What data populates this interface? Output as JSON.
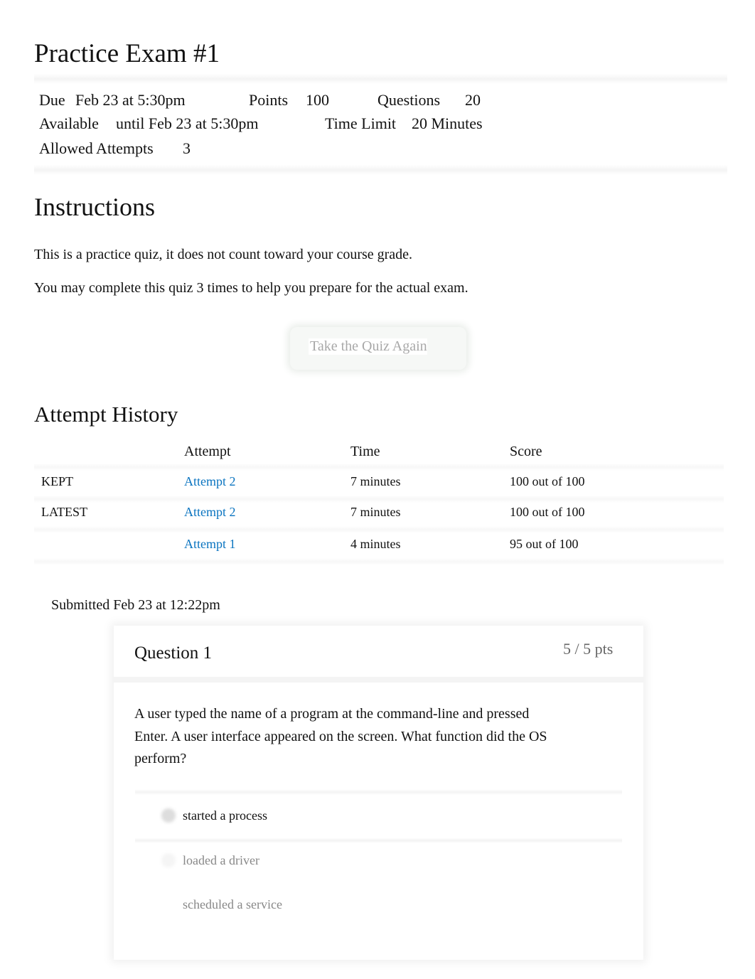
{
  "page_title": "Practice Exam #1",
  "details": {
    "due_label": "Due",
    "due_value": "Feb 23 at 5:30pm",
    "points_label": "Points",
    "points_value": "100",
    "questions_label": "Questions",
    "questions_value": "20",
    "available_label": "Available",
    "available_value": "until Feb 23 at 5:30pm",
    "time_limit_label": "Time Limit",
    "time_limit_value": "20 Minutes",
    "attempts_label": "Allowed Attempts",
    "attempts_value": "3"
  },
  "instructions": {
    "heading": "Instructions",
    "paragraphs": [
      "This is a practice quiz, it does not count toward your course grade.",
      "You may complete this quiz 3 times to help you prepare for the actual exam."
    ]
  },
  "take_quiz_button": "Take the Quiz Again",
  "history": {
    "heading": "Attempt History",
    "columns": [
      "Attempt",
      "Time",
      "Score"
    ],
    "rows": [
      {
        "tag": "KEPT",
        "attempt": "Attempt 2",
        "time": "7 minutes",
        "score": "100 out of 100"
      },
      {
        "tag": "LATEST",
        "attempt": "Attempt 2",
        "time": "7 minutes",
        "score": "100 out of 100"
      },
      {
        "tag": "",
        "attempt": "Attempt 1",
        "time": "4 minutes",
        "score": "95 out of 100"
      }
    ]
  },
  "submitted": "Submitted Feb 23 at 12:22pm",
  "question": {
    "title": "Question 1",
    "points": "5 / 5 pts",
    "text_lines": [
      "A user typed the name of a program at the command-line and pressed",
      "Enter. A user interface appeared on the screen. What function did the OS",
      "perform?"
    ],
    "answers": [
      "started a process",
      "loaded a driver",
      "scheduled a service"
    ],
    "selected_index": 0
  }
}
